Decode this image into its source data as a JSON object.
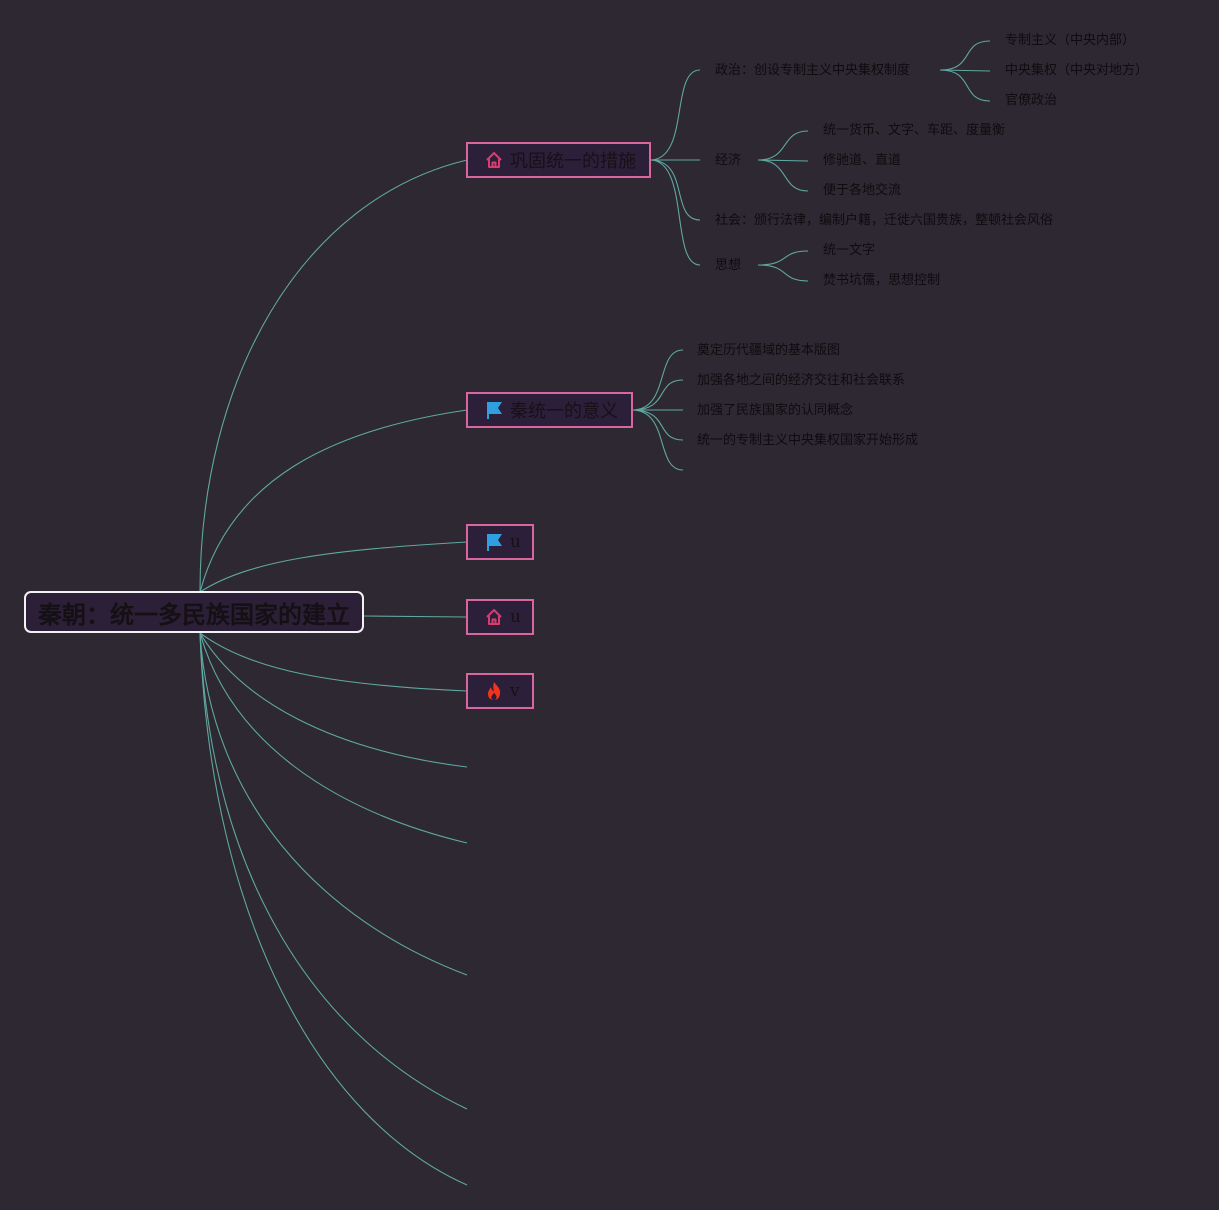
{
  "root": {
    "label": "秦朝：统一多民族国家的建立"
  },
  "branches": [
    {
      "label": "巩固统一的措施",
      "icon": "house-icon",
      "children": [
        {
          "label": "政治：创设专制主义中央集权制度",
          "children": [
            "专制主义（中央内部）",
            "中央集权（中央对地方）",
            "官僚政治"
          ]
        },
        {
          "label": "经济",
          "children": [
            "统一货币、文字、车距、度量衡",
            "修驰道、直道",
            "便于各地交流"
          ]
        },
        {
          "label": "社会：颁行法律，编制户籍，迁徙六国贵族，整顿社会风俗"
        },
        {
          "label": "思想",
          "children": [
            "统一文字",
            "焚书坑儒，思想控制"
          ]
        }
      ]
    },
    {
      "label": "秦统一的意义",
      "icon": "flag-icon",
      "children": [
        {
          "label": "奠定历代疆域的基本版图"
        },
        {
          "label": "加强各地之间的经济交往和社会联系"
        },
        {
          "label": "加强了民族国家的认同概念"
        },
        {
          "label": "统一的专制主义中央集权国家开始形成"
        }
      ]
    },
    {
      "label": "u",
      "icon": "flag-icon"
    },
    {
      "label": "u",
      "icon": "house-icon"
    },
    {
      "label": "v",
      "icon": "fire-icon"
    }
  ],
  "colors": {
    "background": "#2d2832",
    "connector": "#5fa8a0",
    "branch_border": "#d9679d",
    "root_border": "#f2f2f2",
    "house_icon": "#d83c6f",
    "flag_icon": "#2f9fe0",
    "fire_icon": "#f0351e"
  }
}
